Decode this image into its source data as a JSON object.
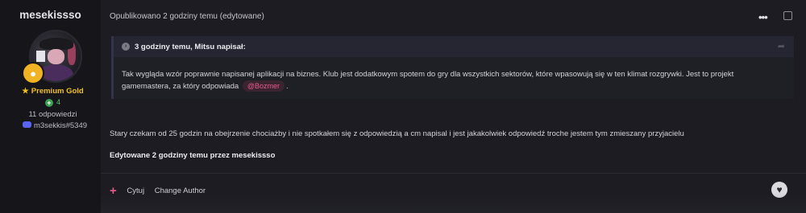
{
  "sidebar": {
    "username": "mesekissso",
    "rank": "Premium Gold",
    "reputation": "4",
    "replies": "11 odpowiedzi",
    "discord": "m3sekkis#5349"
  },
  "post": {
    "meta": "Opublikowano 2 godziny temu (edytowane)",
    "menu_icon": "•••",
    "quote": {
      "title": "3 godziny temu, Mitsu napisał:",
      "text_before_mention": "Tak wygląda wzór poprawnie napisanej aplikacji na biznes. Klub jest dodatkowym spotem do gry dla wszystkich sektorów, które wpasowują się w ten klimat rozgrywki. Jest to projekt gamemastera, za który odpowiada",
      "mention": "@Bozmer",
      "text_after_mention": "."
    },
    "content": "Stary czekam od 25 godzin na obejrzenie chociażby i nie spotkałem się z odpowiedzią a cm napisal i jest jakakolwiek odpowiedź troche jestem tym zmieszany przyjacielu",
    "edited_note": "Edytowane 2 godziny temu przez mesekissso"
  },
  "actions": {
    "add_icon": "+",
    "quote_label": "Cytuj",
    "change_author_label": "Change Author",
    "like_icon": "♥"
  }
}
